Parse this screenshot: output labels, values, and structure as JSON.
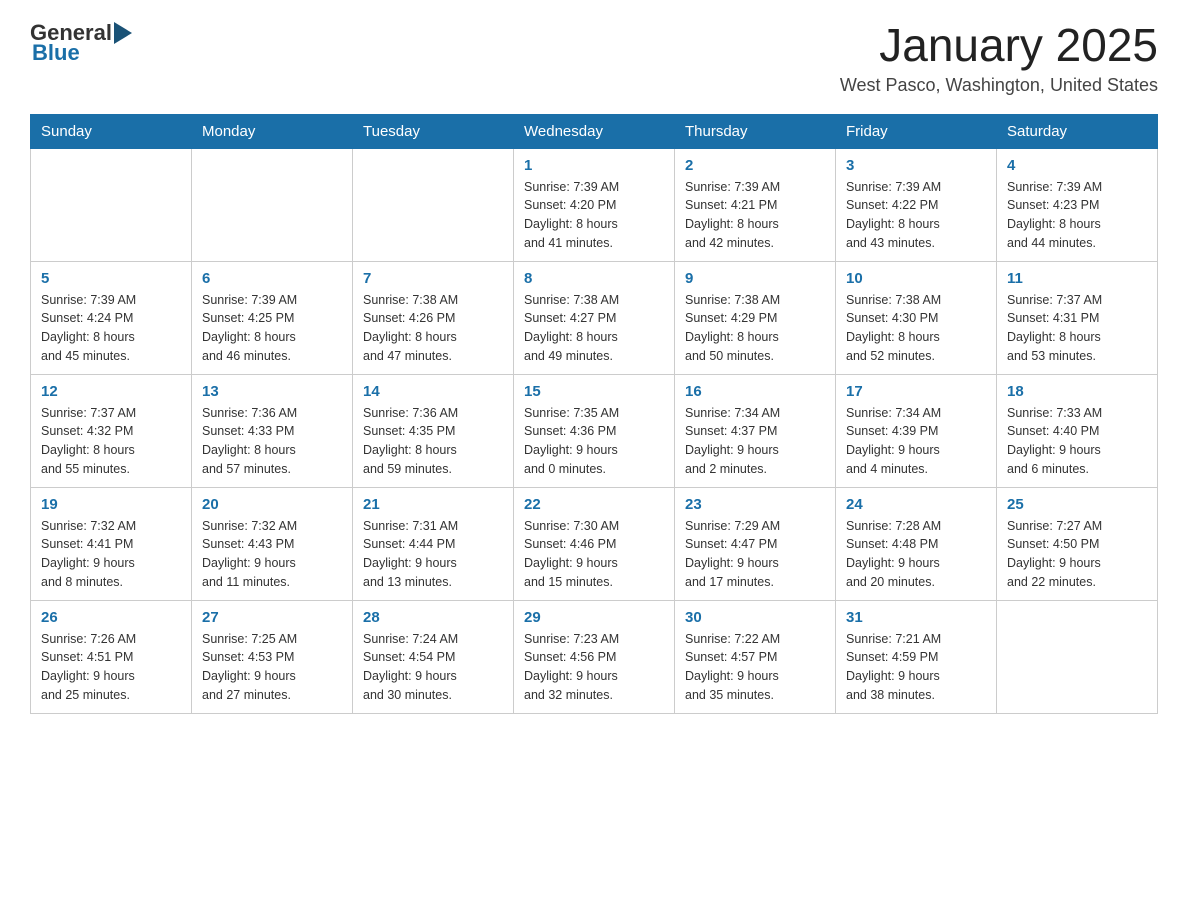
{
  "header": {
    "logo_general": "General",
    "logo_blue": "Blue",
    "title": "January 2025",
    "subtitle": "West Pasco, Washington, United States"
  },
  "days_of_week": [
    "Sunday",
    "Monday",
    "Tuesday",
    "Wednesday",
    "Thursday",
    "Friday",
    "Saturday"
  ],
  "weeks": [
    [
      {
        "day": "",
        "info": ""
      },
      {
        "day": "",
        "info": ""
      },
      {
        "day": "",
        "info": ""
      },
      {
        "day": "1",
        "info": "Sunrise: 7:39 AM\nSunset: 4:20 PM\nDaylight: 8 hours\nand 41 minutes."
      },
      {
        "day": "2",
        "info": "Sunrise: 7:39 AM\nSunset: 4:21 PM\nDaylight: 8 hours\nand 42 minutes."
      },
      {
        "day": "3",
        "info": "Sunrise: 7:39 AM\nSunset: 4:22 PM\nDaylight: 8 hours\nand 43 minutes."
      },
      {
        "day": "4",
        "info": "Sunrise: 7:39 AM\nSunset: 4:23 PM\nDaylight: 8 hours\nand 44 minutes."
      }
    ],
    [
      {
        "day": "5",
        "info": "Sunrise: 7:39 AM\nSunset: 4:24 PM\nDaylight: 8 hours\nand 45 minutes."
      },
      {
        "day": "6",
        "info": "Sunrise: 7:39 AM\nSunset: 4:25 PM\nDaylight: 8 hours\nand 46 minutes."
      },
      {
        "day": "7",
        "info": "Sunrise: 7:38 AM\nSunset: 4:26 PM\nDaylight: 8 hours\nand 47 minutes."
      },
      {
        "day": "8",
        "info": "Sunrise: 7:38 AM\nSunset: 4:27 PM\nDaylight: 8 hours\nand 49 minutes."
      },
      {
        "day": "9",
        "info": "Sunrise: 7:38 AM\nSunset: 4:29 PM\nDaylight: 8 hours\nand 50 minutes."
      },
      {
        "day": "10",
        "info": "Sunrise: 7:38 AM\nSunset: 4:30 PM\nDaylight: 8 hours\nand 52 minutes."
      },
      {
        "day": "11",
        "info": "Sunrise: 7:37 AM\nSunset: 4:31 PM\nDaylight: 8 hours\nand 53 minutes."
      }
    ],
    [
      {
        "day": "12",
        "info": "Sunrise: 7:37 AM\nSunset: 4:32 PM\nDaylight: 8 hours\nand 55 minutes."
      },
      {
        "day": "13",
        "info": "Sunrise: 7:36 AM\nSunset: 4:33 PM\nDaylight: 8 hours\nand 57 minutes."
      },
      {
        "day": "14",
        "info": "Sunrise: 7:36 AM\nSunset: 4:35 PM\nDaylight: 8 hours\nand 59 minutes."
      },
      {
        "day": "15",
        "info": "Sunrise: 7:35 AM\nSunset: 4:36 PM\nDaylight: 9 hours\nand 0 minutes."
      },
      {
        "day": "16",
        "info": "Sunrise: 7:34 AM\nSunset: 4:37 PM\nDaylight: 9 hours\nand 2 minutes."
      },
      {
        "day": "17",
        "info": "Sunrise: 7:34 AM\nSunset: 4:39 PM\nDaylight: 9 hours\nand 4 minutes."
      },
      {
        "day": "18",
        "info": "Sunrise: 7:33 AM\nSunset: 4:40 PM\nDaylight: 9 hours\nand 6 minutes."
      }
    ],
    [
      {
        "day": "19",
        "info": "Sunrise: 7:32 AM\nSunset: 4:41 PM\nDaylight: 9 hours\nand 8 minutes."
      },
      {
        "day": "20",
        "info": "Sunrise: 7:32 AM\nSunset: 4:43 PM\nDaylight: 9 hours\nand 11 minutes."
      },
      {
        "day": "21",
        "info": "Sunrise: 7:31 AM\nSunset: 4:44 PM\nDaylight: 9 hours\nand 13 minutes."
      },
      {
        "day": "22",
        "info": "Sunrise: 7:30 AM\nSunset: 4:46 PM\nDaylight: 9 hours\nand 15 minutes."
      },
      {
        "day": "23",
        "info": "Sunrise: 7:29 AM\nSunset: 4:47 PM\nDaylight: 9 hours\nand 17 minutes."
      },
      {
        "day": "24",
        "info": "Sunrise: 7:28 AM\nSunset: 4:48 PM\nDaylight: 9 hours\nand 20 minutes."
      },
      {
        "day": "25",
        "info": "Sunrise: 7:27 AM\nSunset: 4:50 PM\nDaylight: 9 hours\nand 22 minutes."
      }
    ],
    [
      {
        "day": "26",
        "info": "Sunrise: 7:26 AM\nSunset: 4:51 PM\nDaylight: 9 hours\nand 25 minutes."
      },
      {
        "day": "27",
        "info": "Sunrise: 7:25 AM\nSunset: 4:53 PM\nDaylight: 9 hours\nand 27 minutes."
      },
      {
        "day": "28",
        "info": "Sunrise: 7:24 AM\nSunset: 4:54 PM\nDaylight: 9 hours\nand 30 minutes."
      },
      {
        "day": "29",
        "info": "Sunrise: 7:23 AM\nSunset: 4:56 PM\nDaylight: 9 hours\nand 32 minutes."
      },
      {
        "day": "30",
        "info": "Sunrise: 7:22 AM\nSunset: 4:57 PM\nDaylight: 9 hours\nand 35 minutes."
      },
      {
        "day": "31",
        "info": "Sunrise: 7:21 AM\nSunset: 4:59 PM\nDaylight: 9 hours\nand 38 minutes."
      },
      {
        "day": "",
        "info": ""
      }
    ]
  ]
}
